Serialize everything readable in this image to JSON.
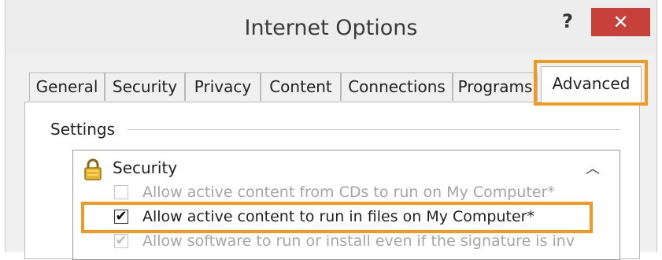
{
  "window": {
    "title": "Internet Options",
    "help_label": "?",
    "close_label": "✕"
  },
  "tabs": [
    {
      "label": "General"
    },
    {
      "label": "Security"
    },
    {
      "label": "Privacy"
    },
    {
      "label": "Content"
    },
    {
      "label": "Connections"
    },
    {
      "label": "Programs"
    },
    {
      "label": "Advanced",
      "selected": true
    }
  ],
  "settings": {
    "group_label": "Settings",
    "category": {
      "label": "Security",
      "icon": "lock-icon"
    },
    "items": [
      {
        "label": "Allow active content from CDs to run on My Computer*",
        "checked": false,
        "enabled": false
      },
      {
        "label": "Allow active content to run in files on My Computer*",
        "checked": true,
        "enabled": true
      },
      {
        "label": "Allow software to run or install even if the signature is inv",
        "checked": true,
        "enabled": false
      }
    ],
    "scroll_up_label": "︿"
  },
  "colors": {
    "highlight": "#ef9a22",
    "close_button": "#c7403a"
  }
}
